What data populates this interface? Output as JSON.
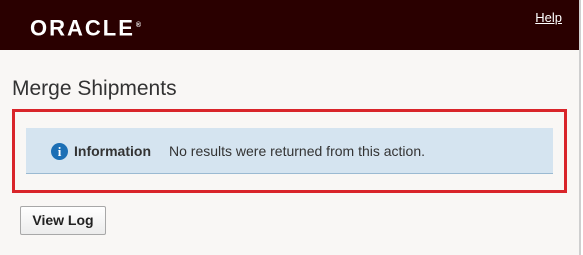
{
  "header": {
    "logo_text": "ORACLE",
    "logo_mark": "®",
    "help_label": "Help"
  },
  "page": {
    "title": "Merge Shipments"
  },
  "message": {
    "icon": "info-icon",
    "icon_glyph": "i",
    "label": "Information",
    "text": "No results were returned from this action."
  },
  "actions": {
    "view_log_label": "View Log"
  },
  "colors": {
    "header_background": "#2a0000",
    "highlight_border": "#d9252a",
    "info_box_background": "#d5e4f0",
    "info_icon": "#1c6fb5"
  }
}
